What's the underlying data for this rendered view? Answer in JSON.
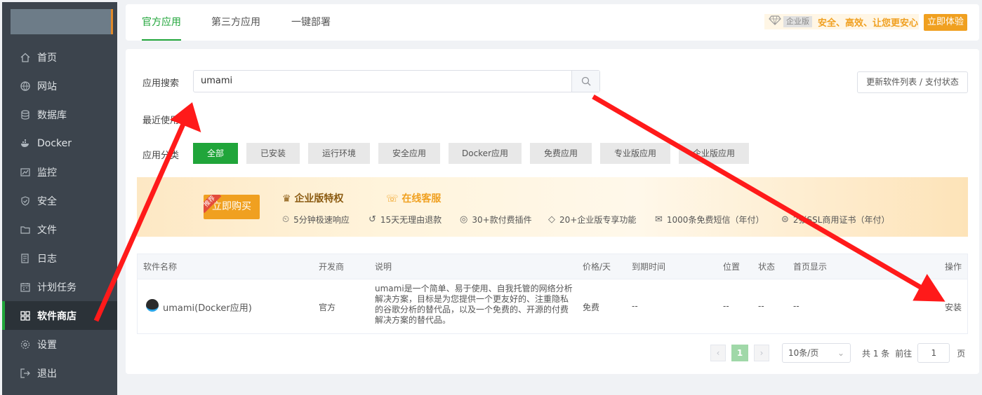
{
  "tabs": [
    "官方应用",
    "第三方应用",
    "一键部署"
  ],
  "enterprise": {
    "label": "企业版",
    "text": "安全、高效、让您更安心",
    "try_label": "立即体验"
  },
  "sidebar": {
    "items": [
      {
        "label": "首页",
        "icon": "home-icon"
      },
      {
        "label": "网站",
        "icon": "globe-icon"
      },
      {
        "label": "数据库",
        "icon": "database-icon"
      },
      {
        "label": "Docker",
        "icon": "docker-icon"
      },
      {
        "label": "监控",
        "icon": "monitor-icon"
      },
      {
        "label": "安全",
        "icon": "shield-icon"
      },
      {
        "label": "文件",
        "icon": "folder-icon"
      },
      {
        "label": "日志",
        "icon": "log-icon"
      },
      {
        "label": "计划任务",
        "icon": "calendar-icon"
      },
      {
        "label": "软件商店",
        "icon": "apps-icon"
      },
      {
        "label": "设置",
        "icon": "gear-icon"
      },
      {
        "label": "退出",
        "icon": "logout-icon"
      }
    ]
  },
  "search": {
    "label": "应用搜索",
    "value": "umami"
  },
  "update_btn": "更新软件列表 / 支付状态",
  "recent_label": "最近使用",
  "category_label": "应用分类",
  "categories": [
    "全部",
    "已安装",
    "运行环境",
    "安全应用",
    "Docker应用",
    "免费应用",
    "专业版应用",
    "企业版应用"
  ],
  "banner": {
    "buy_label": "立即购买",
    "rec": "推荐",
    "title": "企业版特权",
    "service": "在线客服",
    "features": [
      "5分钟极速响应",
      "15天无理由退款",
      "30+款付费插件",
      "20+企业版专享功能",
      "1000条免费短信（年付）",
      "2张SSL商用证书（年付）"
    ]
  },
  "table": {
    "headers": [
      "软件名称",
      "开发商",
      "说明",
      "价格/天",
      "到期时间",
      "位置",
      "状态",
      "首页显示",
      "操作"
    ],
    "rows": [
      {
        "name": "umami(Docker应用)",
        "dev": "官方",
        "desc": "umami是一个简单、易于使用、自我托管的网络分析解决方案，目标是为您提供一个更友好的、注重隐私的谷歌分析的替代品，以及一个免费的、开源的付费解决方案的替代品。",
        "price": "免费",
        "expire": "--",
        "pos": "--",
        "status": "--",
        "home": "--",
        "action": "安装"
      }
    ]
  },
  "pager": {
    "page": "1",
    "size": "10条/页",
    "total": "共 1 条",
    "goto": "前往",
    "goto_val": "1",
    "page_unit": "页"
  },
  "colors": {
    "accent": "#20a53a",
    "orange": "#f0a020",
    "arrow": "#ff1a1a"
  }
}
